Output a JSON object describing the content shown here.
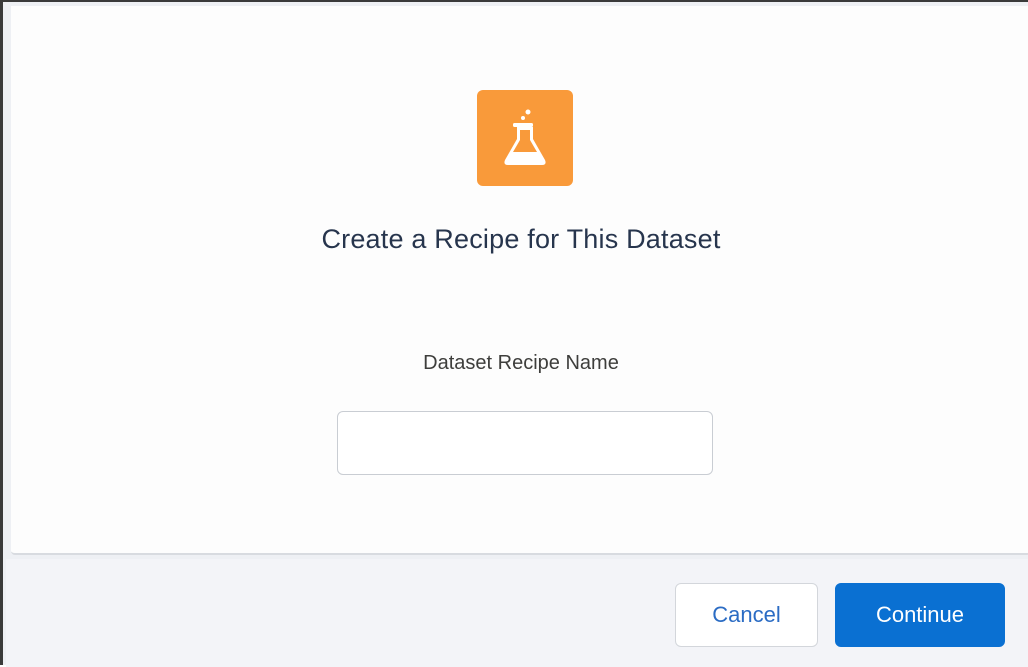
{
  "modal": {
    "icon": "beaker-icon",
    "accent_color": "#f99a3a",
    "title": "Create a Recipe for This Dataset",
    "field_label": "Dataset Recipe Name",
    "name_value": "",
    "name_placeholder": ""
  },
  "footer": {
    "cancel_label": "Cancel",
    "continue_label": "Continue",
    "primary_color": "#0a70d2"
  }
}
